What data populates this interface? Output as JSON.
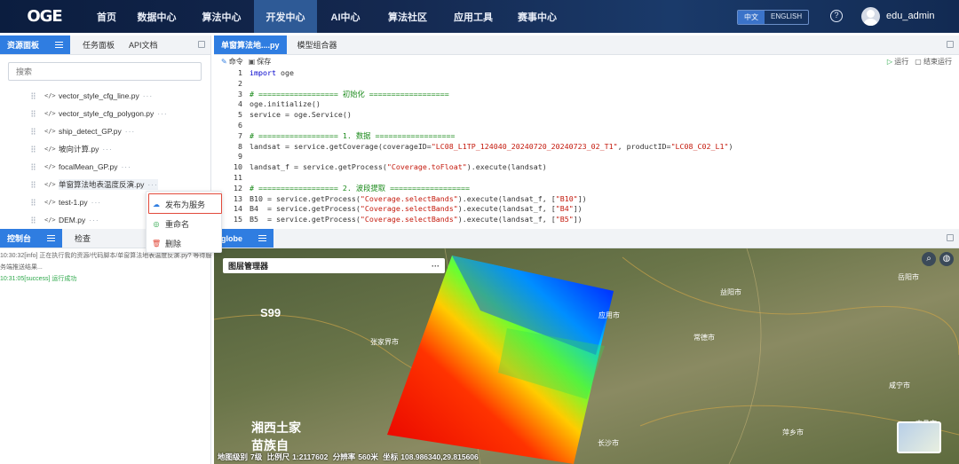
{
  "app": {
    "logo_text": "OGE"
  },
  "nav": {
    "items": [
      "首页",
      "数据中心",
      "算法中心",
      "开发中心",
      "AI中心",
      "算法社区",
      "应用工具",
      "赛事中心"
    ],
    "active_index": 3,
    "lang_cn": "中文",
    "lang_en": "ENGLISH",
    "help": "?",
    "username": "edu_admin"
  },
  "left_panel": {
    "tabs": [
      "资源面板",
      "任务面板",
      "API文档"
    ],
    "search_placeholder": "搜索",
    "files": [
      "vector_style_cfg_line.py",
      "vector_style_cfg_polygon.py",
      "ship_detect_GP.py",
      "坡向计算.py",
      "focalMean_GP.py",
      "单窗算法地表温度反演.py",
      "test-1.py",
      "DEM.py"
    ],
    "more": "···"
  },
  "context_menu": {
    "items": [
      {
        "label": "发布为服务",
        "icon": "cloud-upload-icon"
      },
      {
        "label": "重命名",
        "icon": "check-circle-icon"
      },
      {
        "label": "删除",
        "icon": "trash-icon"
      }
    ]
  },
  "editor": {
    "tabs": [
      "单窗算法地....py",
      "模型组合器"
    ],
    "cmd_label": "命令",
    "save_label": "保存",
    "run_label": "运行",
    "stop_label": "结束运行",
    "line_numbers": [
      "1",
      "2",
      "3",
      "4",
      "5",
      "6",
      "7",
      "8",
      "9",
      "10",
      "11",
      "12",
      "13",
      "14",
      "15"
    ],
    "lines": [
      [
        {
          "t": "import",
          "c": "kw"
        },
        {
          "t": " oge",
          "c": ""
        }
      ],
      [],
      [
        {
          "t": "# ================== 初始化 ==================",
          "c": "cm"
        }
      ],
      [
        {
          "t": "oge.initialize()",
          "c": ""
        }
      ],
      [
        {
          "t": "service = oge.Service()",
          "c": ""
        }
      ],
      [],
      [
        {
          "t": "# ================== 1. 数据 ==================",
          "c": "cm"
        }
      ],
      [
        {
          "t": "landsat = service.getCoverage(coverageID=",
          "c": ""
        },
        {
          "t": "\"LC08_L1TP_124040_20240720_20240723_02_T1\"",
          "c": "st"
        },
        {
          "t": ", productID=",
          "c": ""
        },
        {
          "t": "\"LC08_C02_L1\"",
          "c": "st"
        },
        {
          "t": ")",
          "c": ""
        }
      ],
      [],
      [
        {
          "t": "landsat_f = service.getProcess(",
          "c": ""
        },
        {
          "t": "\"Coverage.toFloat\"",
          "c": "st"
        },
        {
          "t": ").execute(landsat)",
          "c": ""
        }
      ],
      [],
      [
        {
          "t": "# ================== 2. 波段提取 ==================",
          "c": "cm"
        }
      ],
      [
        {
          "t": "B10 = service.getProcess(",
          "c": ""
        },
        {
          "t": "\"Coverage.selectBands\"",
          "c": "st"
        },
        {
          "t": ").execute(landsat_f, [",
          "c": ""
        },
        {
          "t": "\"B10\"",
          "c": "st"
        },
        {
          "t": "])",
          "c": ""
        }
      ],
      [
        {
          "t": "B4  = service.getProcess(",
          "c": ""
        },
        {
          "t": "\"Coverage.selectBands\"",
          "c": "st"
        },
        {
          "t": ").execute(landsat_f, [",
          "c": ""
        },
        {
          "t": "\"B4\"",
          "c": "st"
        },
        {
          "t": "])",
          "c": ""
        }
      ],
      [
        {
          "t": "B5  = service.getProcess(",
          "c": ""
        },
        {
          "t": "\"Coverage.selectBands\"",
          "c": "st"
        },
        {
          "t": ").execute(landsat_f, [",
          "c": ""
        },
        {
          "t": "\"B5\"",
          "c": "st"
        },
        {
          "t": "])",
          "c": ""
        }
      ]
    ]
  },
  "console": {
    "tabs": [
      "控制台",
      "检查"
    ],
    "logs": [
      {
        "text": "10:30:32[info] 正在执行我的资源/代码脚本/单窗算法地表温度反演.py? 等待服",
        "status": "info"
      },
      {
        "text": "务端推送结果...",
        "status": "info"
      },
      {
        "text": "10:31:05[success] 运行成功",
        "status": "success"
      }
    ]
  },
  "map": {
    "tab": "globe",
    "layer_manager": "图层管理器",
    "layer_menu": "···",
    "labels": [
      "S99",
      "张家界市",
      "常德市",
      "益阳市",
      "岳阳市",
      "咸宁市",
      "南昌市",
      "萍乡市",
      "应用市",
      "长沙市",
      "湘西土家",
      "苗族自"
    ],
    "status": {
      "level_label": "地图级别",
      "level": "7级",
      "scale_label": "比例尺",
      "scale": "1:2117602",
      "res_label": "分辨率",
      "res": "560米",
      "coord_label": "坐标",
      "coord": "108.986340,29.815606"
    }
  },
  "colors": {
    "accent": "#2f7de1",
    "nav_bg": "#14284f",
    "highlight": "#e24a3b"
  }
}
